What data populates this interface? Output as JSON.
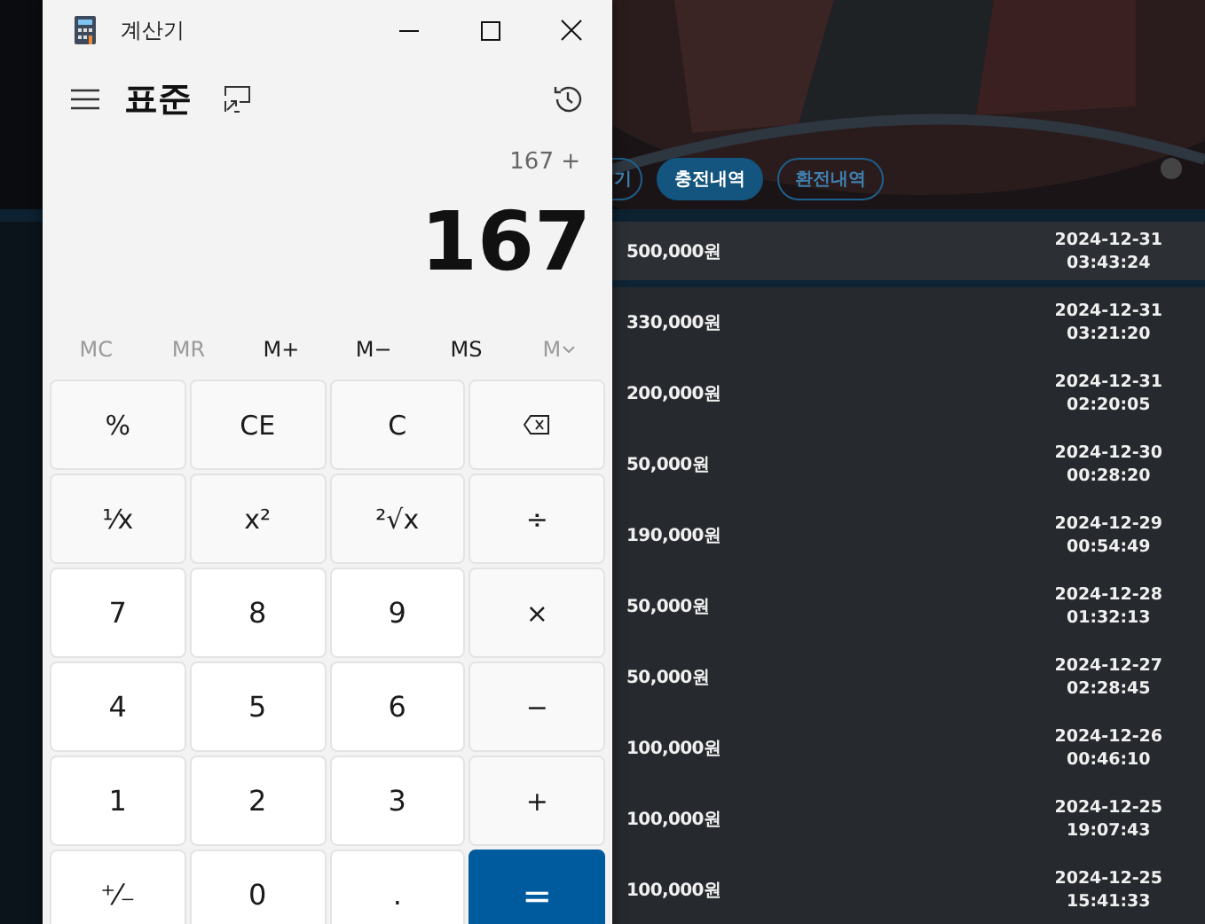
{
  "page": {
    "tabs": [
      {
        "label": "기",
        "selected": false
      },
      {
        "label": "충전내역",
        "selected": true
      },
      {
        "label": "환전내역",
        "selected": false
      }
    ],
    "rows": [
      {
        "amount": "500,000원",
        "date": "2024-12-31",
        "time": "03:43:24",
        "selected": true
      },
      {
        "amount": "330,000원",
        "date": "2024-12-31",
        "time": "03:21:20",
        "selected": false
      },
      {
        "amount": "200,000원",
        "date": "2024-12-31",
        "time": "02:20:05",
        "selected": false
      },
      {
        "amount": "50,000원",
        "date": "2024-12-30",
        "time": "00:28:20",
        "selected": false
      },
      {
        "amount": "190,000원",
        "date": "2024-12-29",
        "time": "00:54:49",
        "selected": false
      },
      {
        "amount": "50,000원",
        "date": "2024-12-28",
        "time": "01:32:13",
        "selected": false
      },
      {
        "amount": "50,000원",
        "date": "2024-12-27",
        "time": "02:28:45",
        "selected": false
      },
      {
        "amount": "100,000원",
        "date": "2024-12-26",
        "time": "00:46:10",
        "selected": false
      },
      {
        "amount": "100,000원",
        "date": "2024-12-25",
        "time": "19:07:43",
        "selected": false
      },
      {
        "amount": "100,000원",
        "date": "2024-12-25",
        "time": "15:41:33",
        "selected": false
      }
    ]
  },
  "window": {
    "title": "계산기",
    "mode": "표준",
    "expression": "167 +",
    "display": "167",
    "memory": [
      {
        "label": "MC",
        "disabled": true,
        "kind": "plain"
      },
      {
        "label": "MR",
        "disabled": true,
        "kind": "plain"
      },
      {
        "label": "M+",
        "disabled": false,
        "kind": "plain"
      },
      {
        "label": "M−",
        "disabled": false,
        "kind": "plain"
      },
      {
        "label": "MS",
        "disabled": false,
        "kind": "plain"
      },
      {
        "label": "M",
        "disabled": true,
        "kind": "dropdown"
      }
    ],
    "keys": [
      {
        "label": "%",
        "kind": "function"
      },
      {
        "label": "CE",
        "kind": "function"
      },
      {
        "label": "C",
        "kind": "function"
      },
      {
        "kind": "backspace"
      },
      {
        "label": "¹⁄x",
        "kind": "function"
      },
      {
        "label": "x²",
        "kind": "function"
      },
      {
        "label": "²√x",
        "kind": "function"
      },
      {
        "label": "÷",
        "kind": "function"
      },
      {
        "label": "7",
        "kind": "number"
      },
      {
        "label": "8",
        "kind": "number"
      },
      {
        "label": "9",
        "kind": "number"
      },
      {
        "label": "×",
        "kind": "function"
      },
      {
        "label": "4",
        "kind": "number"
      },
      {
        "label": "5",
        "kind": "number"
      },
      {
        "label": "6",
        "kind": "number"
      },
      {
        "label": "−",
        "kind": "function"
      },
      {
        "label": "1",
        "kind": "number"
      },
      {
        "label": "2",
        "kind": "number"
      },
      {
        "label": "3",
        "kind": "number"
      },
      {
        "label": "+",
        "kind": "function"
      },
      {
        "label": "⁺⁄₋",
        "kind": "number"
      },
      {
        "label": "0",
        "kind": "number"
      },
      {
        "label": ".",
        "kind": "number"
      },
      {
        "label": "=",
        "kind": "equals"
      }
    ]
  }
}
